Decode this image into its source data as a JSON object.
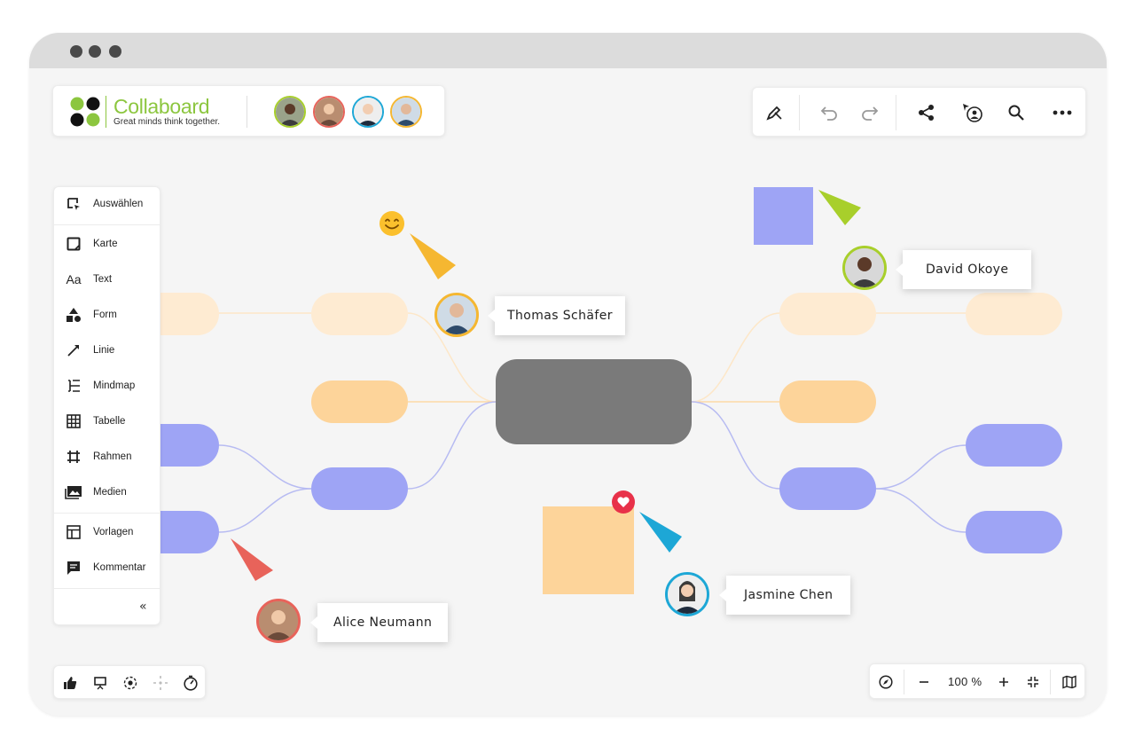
{
  "app": {
    "name": "Collaboard",
    "tagline": "Great minds think together."
  },
  "toolbar_right": {
    "items": [
      "pen-icon",
      "undo-icon",
      "redo-icon",
      "share-icon",
      "follow-icon",
      "search-icon",
      "more-icon"
    ]
  },
  "tools": [
    {
      "label": "Auswählen",
      "icon": "select-icon"
    },
    {
      "label": "Karte",
      "icon": "card-icon"
    },
    {
      "label": "Text",
      "icon": "text-icon"
    },
    {
      "label": "Form",
      "icon": "shape-icon"
    },
    {
      "label": "Linie",
      "icon": "line-icon"
    },
    {
      "label": "Mindmap",
      "icon": "mindmap-icon"
    },
    {
      "label": "Tabelle",
      "icon": "table-icon"
    },
    {
      "label": "Rahmen",
      "icon": "frame-icon"
    },
    {
      "label": "Medien",
      "icon": "media-icon"
    },
    {
      "label": "Vorlagen",
      "icon": "templates-icon"
    },
    {
      "label": "Kommentar",
      "icon": "comment-icon"
    }
  ],
  "tools_icon_text": "Aa",
  "collapse_glyph": "«",
  "cursors": [
    {
      "name": "Thomas Schäfer",
      "color": "#f5b731"
    },
    {
      "name": "David Okoye",
      "color": "#a8cf2b"
    },
    {
      "name": "Alice Neumann",
      "color": "#e8635a"
    },
    {
      "name": "Jasmine Chen",
      "color": "#1da7d6"
    }
  ],
  "zoom": {
    "value": "100 %"
  },
  "colors": {
    "brand": "#8cc63f",
    "orange_node": "#fdd49a",
    "orange_node_faded": "#feebd2",
    "purple_node": "#9ea4f5",
    "center_node": "#7a7a7a",
    "sticky_orange": "#fdd49a",
    "sticky_purple": "#9ea4f5"
  }
}
